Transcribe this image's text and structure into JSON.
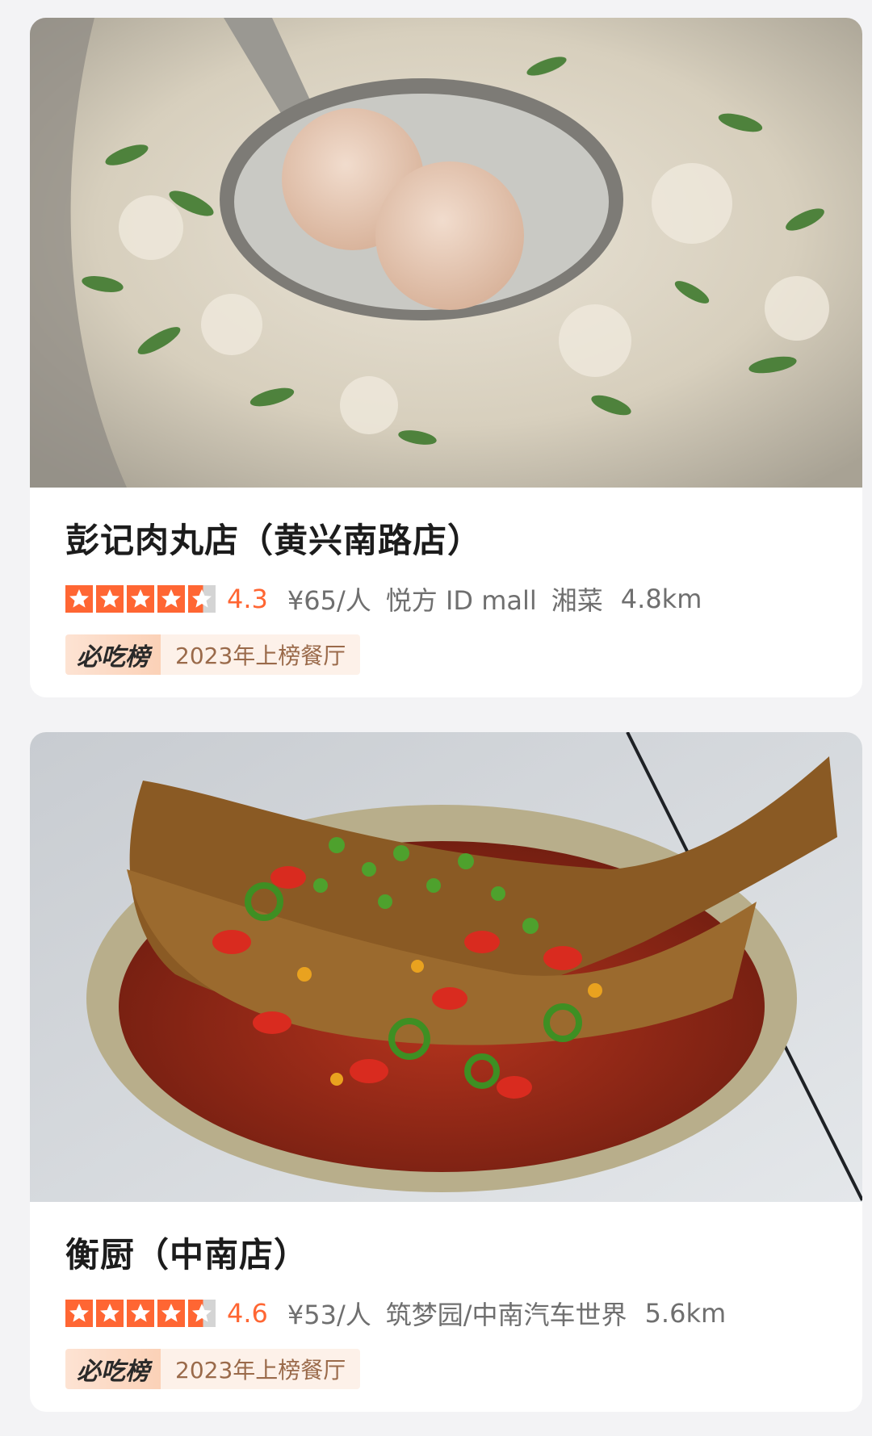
{
  "restaurants": [
    {
      "name": "彭记肉丸店（黄兴南路店）",
      "rating": 4.3,
      "rating_text": "4.3",
      "price": "¥65/人",
      "area": "悦方 ID mall",
      "cuisine": "湘菜",
      "distance": "4.8km",
      "badge_logo": "必吃榜",
      "badge_text": "2023年上榜餐厅",
      "photo_icon": "meatball-soup-photo"
    },
    {
      "name": "衡厨（中南店）",
      "rating": 4.6,
      "rating_text": "4.6",
      "price": "¥53/人",
      "area": "筑梦园/中南汽车世界",
      "cuisine": "",
      "distance": "5.6km",
      "badge_logo": "必吃榜",
      "badge_text": "2023年上榜餐厅",
      "photo_icon": "braised-fish-photo"
    }
  ],
  "colors": {
    "accent": "#ff6633",
    "star_empty": "#d4d4d4",
    "badge_text": "#9a6a4a",
    "background": "#f3f3f5"
  }
}
